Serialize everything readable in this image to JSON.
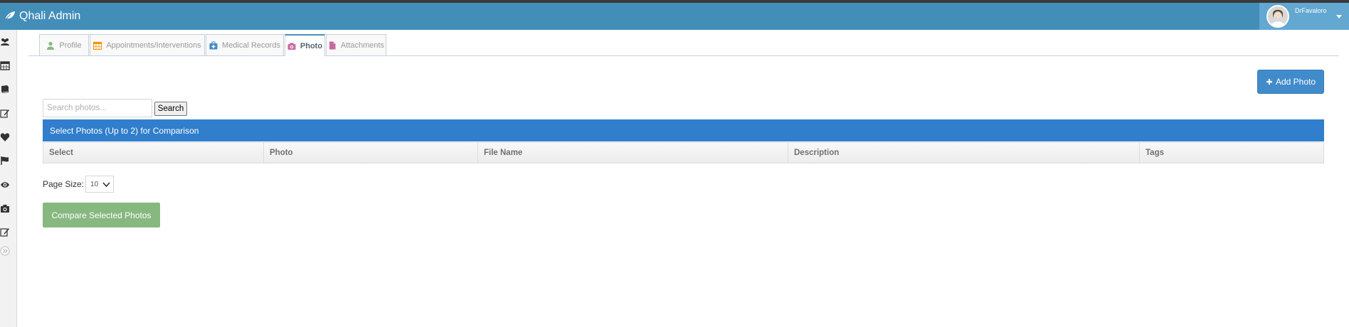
{
  "app": {
    "title": "Qhali Admin"
  },
  "user": {
    "name": "DrFavaloro"
  },
  "sidebar": {
    "items": [
      {
        "icon": "users-icon"
      },
      {
        "icon": "calendar-icon"
      },
      {
        "icon": "book-icon"
      },
      {
        "icon": "edit-icon"
      },
      {
        "icon": "heart-icon"
      },
      {
        "icon": "flag-icon"
      },
      {
        "icon": "eye-icon"
      },
      {
        "icon": "camera-icon"
      },
      {
        "icon": "edit-icon"
      },
      {
        "icon": "collapse-icon"
      }
    ]
  },
  "tabs": [
    {
      "label": "Profile",
      "icon": "user-icon",
      "icon_color": "#87b87f"
    },
    {
      "label": "Appointments/Interventions",
      "icon": "calendar-icon",
      "icon_color": "#f89406"
    },
    {
      "label": "Medical Records",
      "icon": "medkit-icon",
      "icon_color": "#428bca"
    },
    {
      "label": "Photo",
      "icon": "camera-icon",
      "icon_color": "#c6699f",
      "active": true
    },
    {
      "label": "Attachments",
      "icon": "file-icon",
      "icon_color": "#c6699f"
    }
  ],
  "photos": {
    "add_label": "Add Photo",
    "search_placeholder": "Search photos...",
    "search_button": "Search",
    "table_caption": "Select Photos (Up to 2) for Comparison",
    "columns": [
      "Select",
      "Photo",
      "File Name",
      "Description",
      "Tags"
    ],
    "page_size_label": "Page Size:",
    "page_size_value": "10",
    "compare_label": "Compare Selected Photos"
  },
  "colors": {
    "navbar": "#438eb9",
    "user_area": "#62a8d1",
    "caption": "#307ecc",
    "add_button": "#428bca",
    "compare_button": "#87b87f"
  }
}
